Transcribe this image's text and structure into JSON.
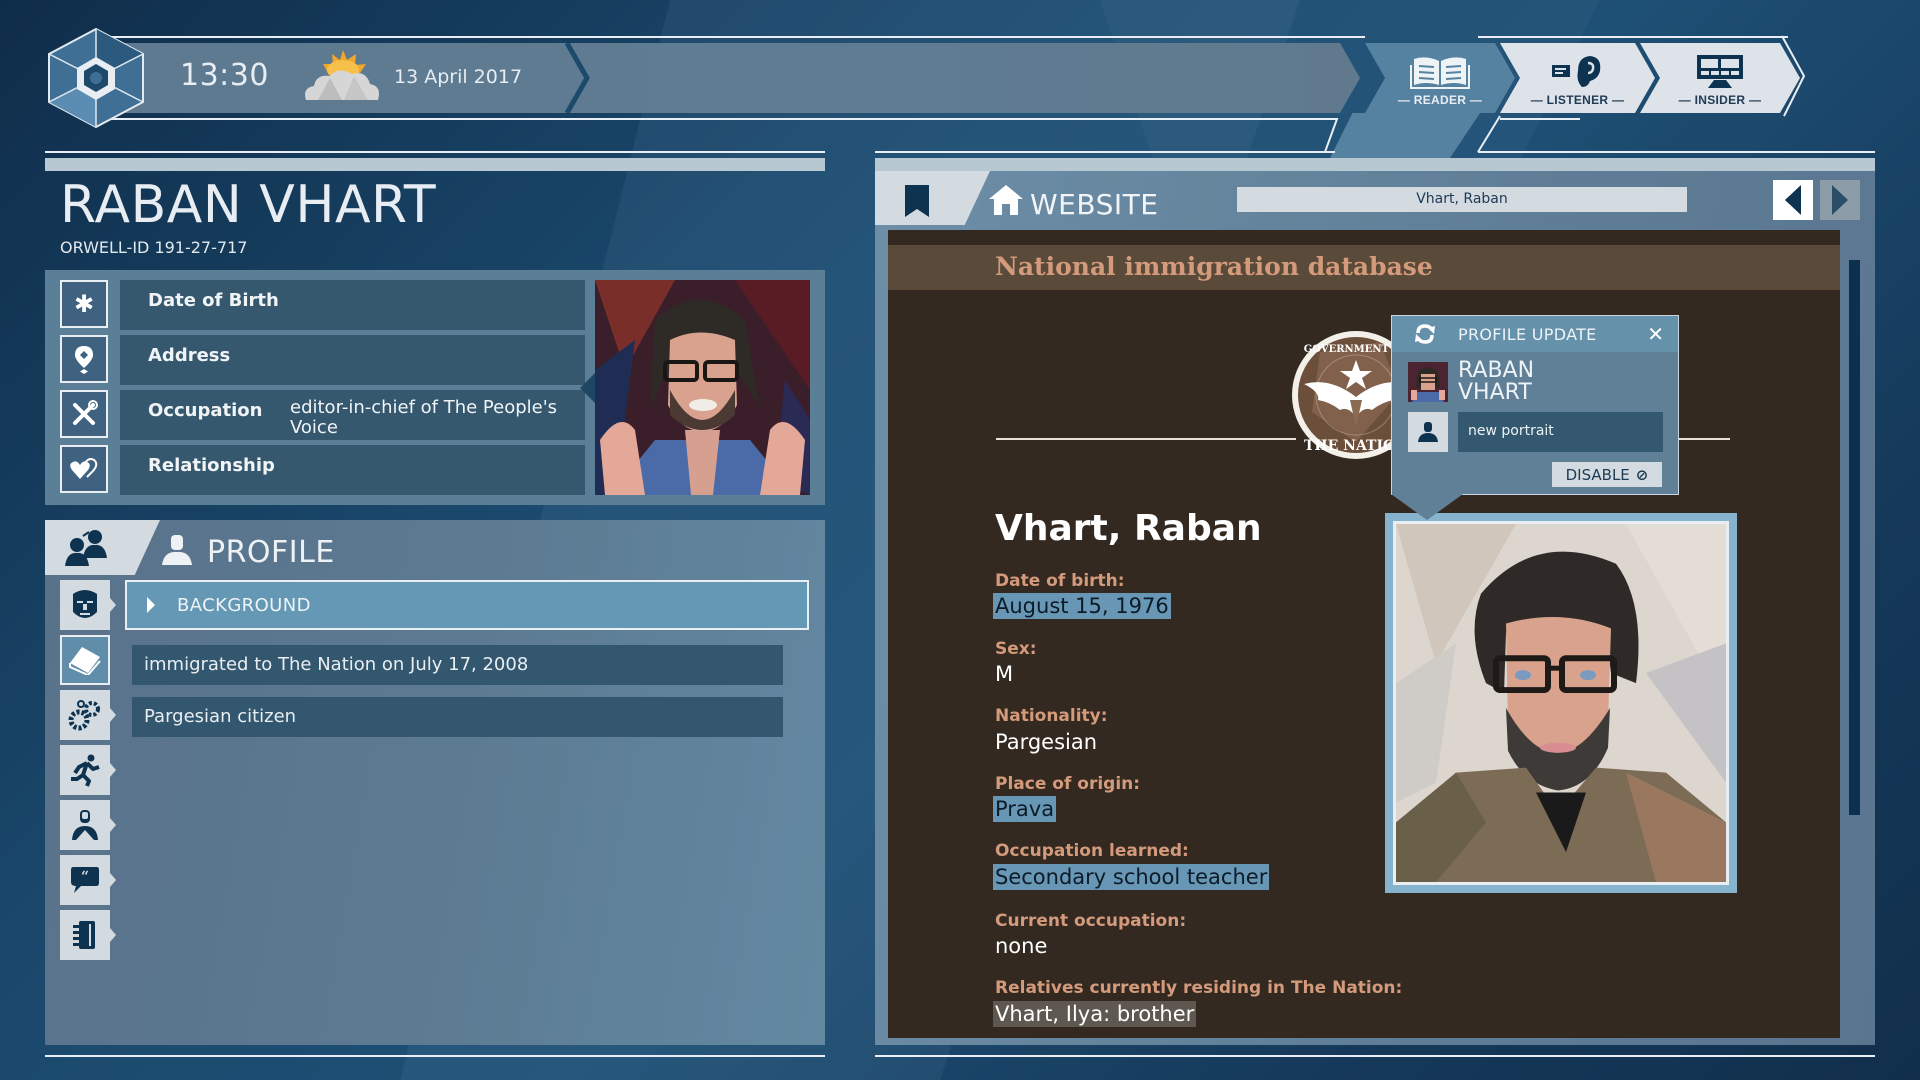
{
  "topbar": {
    "time": "13:30",
    "weather_icon": "sun-behind-cloud-icon",
    "date": "13 April 2017",
    "modes": [
      {
        "label": "— READER —",
        "icon": "open-book-icon",
        "active": true
      },
      {
        "label": "— LISTENER —",
        "icon": "ear-icon",
        "active": false
      },
      {
        "label": "— INSIDER —",
        "icon": "monitor-icon",
        "active": false
      }
    ]
  },
  "person": {
    "name": "RABAN VHART",
    "orwell_id": "ORWELL-ID  191-27-717",
    "fields": [
      {
        "icon": "asterisk-icon",
        "label": "Date of Birth",
        "value": ""
      },
      {
        "icon": "location-pin-icon",
        "label": "Address",
        "value": ""
      },
      {
        "icon": "tools-icon",
        "label": "Occupation",
        "value": "editor-in-chief of The People's Voice"
      },
      {
        "icon": "hearts-icon",
        "label": "Relationship",
        "value": ""
      }
    ]
  },
  "profile": {
    "title": "PROFILE",
    "section_header": "BACKGROUND",
    "items": [
      "immigrated to The Nation on July 17, 2008",
      "Pargesian citizen"
    ],
    "side_icons": [
      "face-icon",
      "book-icon",
      "gears-icon",
      "running-person-icon",
      "person-badge-icon",
      "quote-bubble-icon",
      "notebook-icon"
    ]
  },
  "browser": {
    "tab_label": "WEBSITE",
    "url": "Vhart, Raban",
    "site_title": "National immigration database",
    "seal_text_top": "GOVERNMENT OF",
    "seal_text_bottom": "THE NATION",
    "record": {
      "name": "Vhart, Raban",
      "fields": [
        {
          "label": "Date of birth:",
          "value": "August 15, 1976",
          "style": "hl"
        },
        {
          "label": "Sex:",
          "value": "M",
          "style": ""
        },
        {
          "label": "Nationality:",
          "value": "Pargesian",
          "style": ""
        },
        {
          "label": "Place of origin:",
          "value": "Prava",
          "style": "hl"
        },
        {
          "label": "Occupation learned:",
          "value": "Secondary school teacher",
          "style": "hl"
        },
        {
          "label": "Current occupation:",
          "value": "none",
          "style": ""
        },
        {
          "label": "Relatives currently residing in The Nation:",
          "value": "Vhart, Ilya: brother",
          "style": "gray"
        }
      ]
    }
  },
  "popup": {
    "title": "PROFILE UPDATE",
    "close": "✕",
    "name_line1": "RABAN",
    "name_line2": "VHART",
    "update_text": "new portrait",
    "disable_label": "DISABLE",
    "disable_icon": "⊘"
  },
  "colors": {
    "accent_blue": "#6598b5",
    "highlight": "#6797b4",
    "label_salmon": "#d49a7c",
    "site_bg": "#332920"
  }
}
